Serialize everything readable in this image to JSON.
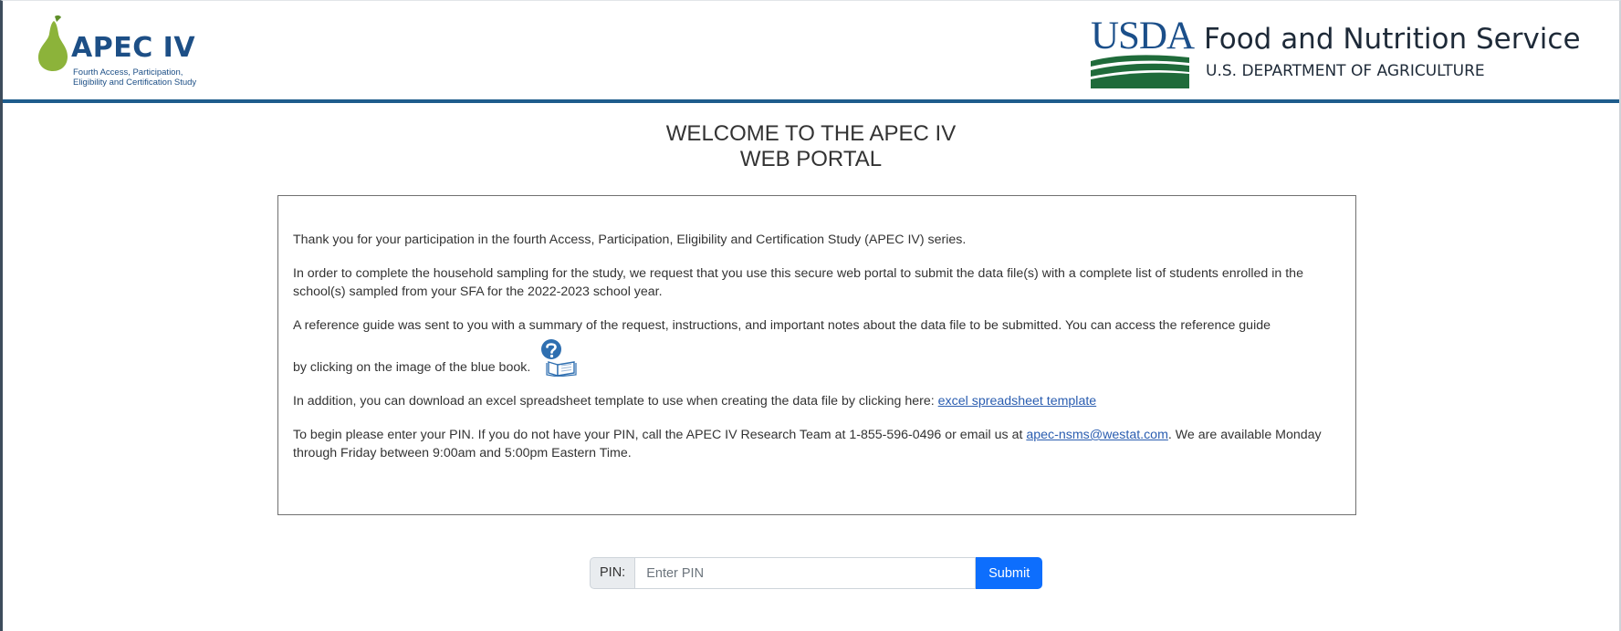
{
  "header": {
    "apec_logo": {
      "title": "APEC IV",
      "subtitle_line1": "Fourth Access, Participation,",
      "subtitle_line2": "Eligibility and Certification Study",
      "icon": "pear-icon"
    },
    "usda": {
      "mark_text": "USDA",
      "agency": "Food and Nutrition Service",
      "department": "U.S. DEPARTMENT OF AGRICULTURE",
      "icon": "usda-logo"
    }
  },
  "welcome": {
    "line1": "WELCOME TO THE APEC IV",
    "line2": "WEB PORTAL"
  },
  "info": {
    "p1": "Thank you for your participation in the fourth Access, Participation, Eligibility and Certification Study (APEC IV) series.",
    "p2": "In order to complete the household sampling for the study, we request that you use this secure web portal to submit the data file(s) with a complete list of students enrolled in the school(s) sampled from your SFA for the 2022-2023 school year.",
    "p3_line1": "A reference guide was sent to you with a summary of the request, instructions, and important notes about the data file to be submitted. You can access the reference guide",
    "p3_line2": "by clicking on the image of the blue book.",
    "reference_guide_icon": "blue-book-help-icon",
    "p4_prefix": "In addition, you can download an excel spreadsheet template to use when creating the data file by clicking here: ",
    "p4_link": "excel spreadsheet template",
    "p5_prefix": "To begin please enter your PIN. If you do not have your PIN, call the APEC IV Research Team at 1-855-596-0496 or email us at ",
    "p5_email": "apec-nsms@westat.com",
    "p5_suffix": ". We are available Monday through Friday between 9:00am and 5:00pm Eastern Time."
  },
  "pin_form": {
    "label": "PIN:",
    "placeholder": "Enter PIN",
    "value": "",
    "submit_label": "Submit"
  },
  "colors": {
    "header_rule": "#1e5c8c",
    "apec_blue": "#1d4f86",
    "pear_green": "#8cb33a",
    "usda_green": "#1f6b3a",
    "usda_blue": "#1b4f8a",
    "submit_blue": "#0d6efd",
    "link_blue": "#2a5db0"
  }
}
